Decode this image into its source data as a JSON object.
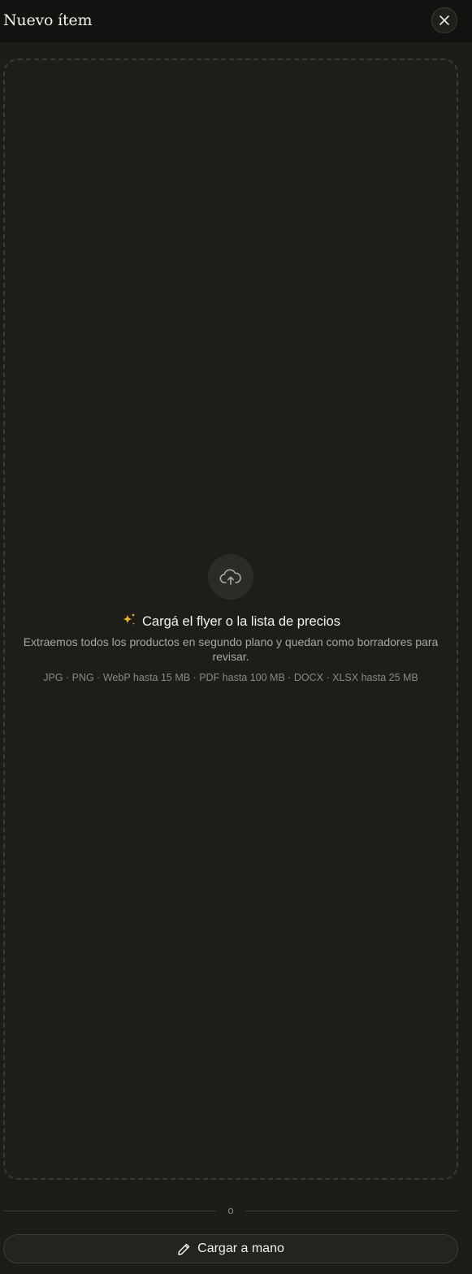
{
  "header": {
    "title": "Nuevo ítem",
    "close_icon": "close-icon"
  },
  "dropzone": {
    "upload_icon": "cloud-upload-icon",
    "sparkle_icon": "sparkle-icon",
    "heading": "Cargá el flyer o la lista de precios",
    "subtitle": "Extraemos todos los productos en segundo plano y quedan como borradores para revisar.",
    "formats": "JPG · PNG · WebP hasta 15 MB · PDF hasta 100 MB · DOCX · XLSX hasta 25 MB"
  },
  "divider": {
    "text": "o"
  },
  "manual_button": {
    "icon": "pencil-icon",
    "label": "Cargar a mano"
  },
  "colors": {
    "background": "#1c1c19",
    "header_background": "#121210",
    "accent_sparkle": "#f0b429"
  }
}
